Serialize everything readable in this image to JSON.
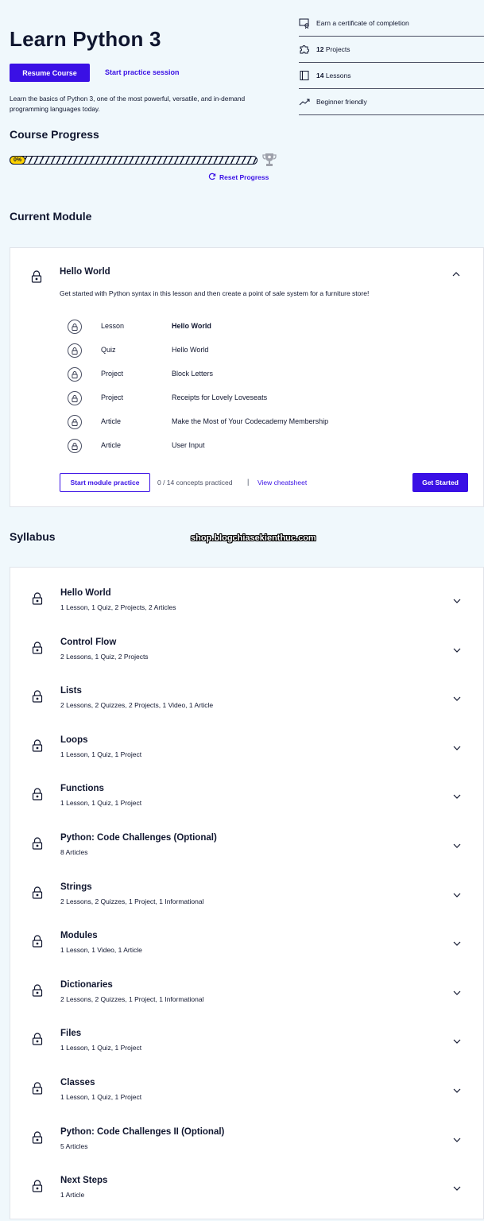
{
  "header": {
    "title": "Learn Python 3",
    "resume_label": "Resume Course",
    "practice_label": "Start practice session",
    "description": "Learn the basics of Python 3, one of the most powerful, versatile, and in-demand programming languages today."
  },
  "info": [
    {
      "icon": "certificate-icon",
      "bold": "",
      "text": "Earn a certificate of completion"
    },
    {
      "icon": "puzzle-icon",
      "bold": "12",
      "text": " Projects"
    },
    {
      "icon": "book-icon",
      "bold": "14",
      "text": " Lessons"
    },
    {
      "icon": "trend-up-icon",
      "bold": "",
      "text": "Beginner friendly"
    }
  ],
  "progress": {
    "title": "Course Progress",
    "percent_label": "0%",
    "percent": 0,
    "reset_label": "Reset Progress"
  },
  "current_module": {
    "section_title": "Current Module",
    "title": "Hello World",
    "description": "Get started with Python syntax in this lesson and then create a point of sale system for a furniture store!",
    "items": [
      {
        "type": "Lesson",
        "name": "Hello World",
        "bold": true
      },
      {
        "type": "Quiz",
        "name": "Hello World",
        "bold": false
      },
      {
        "type": "Project",
        "name": "Block Letters",
        "bold": false
      },
      {
        "type": "Project",
        "name": "Receipts for Lovely Loveseats",
        "bold": false
      },
      {
        "type": "Article",
        "name": "Make the Most of Your Codecademy Membership",
        "bold": false
      },
      {
        "type": "Article",
        "name": "User Input",
        "bold": false
      }
    ],
    "module_practice_label": "Start module practice",
    "concepts_text": "0 / 14 concepts practiced",
    "separator": "|",
    "cheatsheet_label": "View cheatsheet",
    "get_started_label": "Get Started"
  },
  "watermark": "shop.blogchiasekienthuc.com",
  "syllabus": {
    "section_title": "Syllabus",
    "modules": [
      {
        "title": "Hello World",
        "subtitle": "1 Lesson, 1 Quiz, 2 Projects, 2 Articles"
      },
      {
        "title": "Control Flow",
        "subtitle": "2 Lessons, 1 Quiz, 2 Projects"
      },
      {
        "title": "Lists",
        "subtitle": "2 Lessons, 2 Quizzes, 2 Projects, 1 Video, 1 Article"
      },
      {
        "title": "Loops",
        "subtitle": "1 Lesson, 1 Quiz, 1 Project"
      },
      {
        "title": "Functions",
        "subtitle": "1 Lesson, 1 Quiz, 1 Project"
      },
      {
        "title": "Python: Code Challenges (Optional)",
        "subtitle": "8 Articles"
      },
      {
        "title": "Strings",
        "subtitle": "2 Lessons, 2 Quizzes, 1 Project, 1 Informational"
      },
      {
        "title": "Modules",
        "subtitle": "1 Lesson, 1 Video, 1 Article"
      },
      {
        "title": "Dictionaries",
        "subtitle": "2 Lessons, 2 Quizzes, 1 Project, 1 Informational"
      },
      {
        "title": "Files",
        "subtitle": "1 Lesson, 1 Quiz, 1 Project"
      },
      {
        "title": "Classes",
        "subtitle": "1 Lesson, 1 Quiz, 1 Project"
      },
      {
        "title": "Python: Code Challenges II (Optional)",
        "subtitle": "5 Articles"
      },
      {
        "title": "Next Steps",
        "subtitle": "1 Article"
      }
    ]
  },
  "colors": {
    "accent": "#3a10e5",
    "text": "#10162f",
    "background": "#f0f8fc",
    "progress_badge": "#ffd300"
  }
}
